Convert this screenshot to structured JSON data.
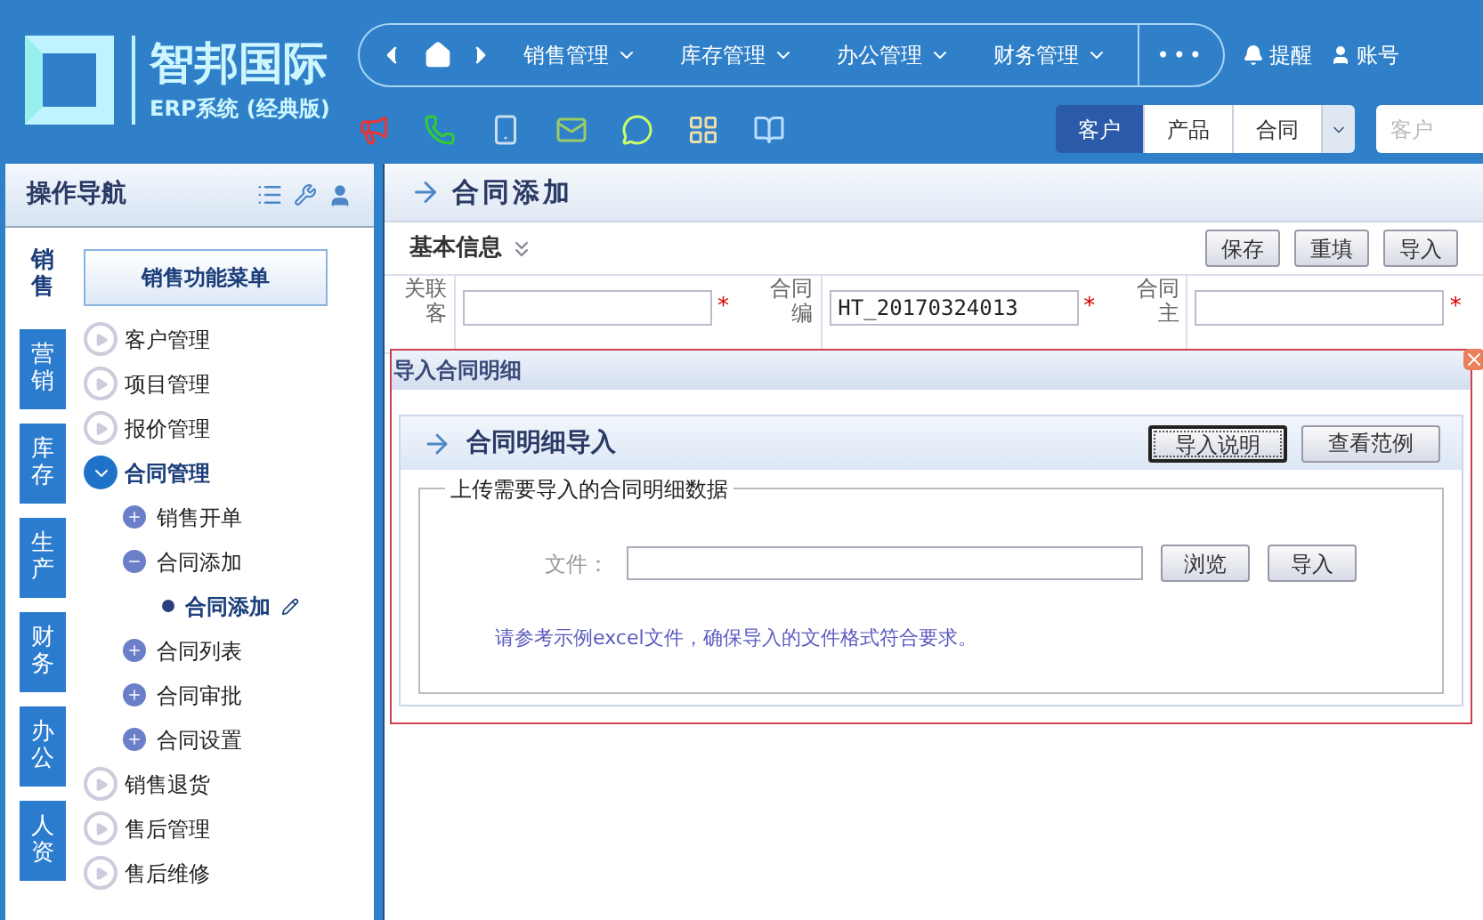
{
  "logo": {
    "title": "智邦国际",
    "subtitle": "ERP系统 (经典版)"
  },
  "nav": {
    "menus": [
      "销售管理",
      "库存管理",
      "办公管理",
      "财务管理"
    ],
    "more": "•••"
  },
  "user_links": [
    {
      "kind": "bell",
      "label": "提醒"
    },
    {
      "kind": "user",
      "label": "账号"
    }
  ],
  "toolbar_icons": [
    {
      "kind": "megaphone"
    },
    {
      "kind": "phone"
    },
    {
      "kind": "mobile"
    },
    {
      "kind": "mail"
    },
    {
      "kind": "chat"
    },
    {
      "kind": "grid"
    },
    {
      "kind": "book"
    }
  ],
  "search_tabs": [
    {
      "label": "客户",
      "selected": true
    },
    {
      "label": "产品",
      "selected": false
    },
    {
      "label": "合同",
      "selected": false
    }
  ],
  "search": {
    "placeholder": "客户"
  },
  "sidebar": {
    "title": "操作导航",
    "tabs": [
      {
        "label": "销售",
        "selected": true
      },
      {
        "label": "营销",
        "selected": false
      },
      {
        "label": "库存",
        "selected": false
      },
      {
        "label": "生产",
        "selected": false
      },
      {
        "label": "财务",
        "selected": false
      },
      {
        "label": "办公",
        "selected": false
      },
      {
        "label": "人资",
        "selected": false
      }
    ],
    "menu_title": "销售功能菜单",
    "tree": [
      {
        "label": "客户管理",
        "expanded": false
      },
      {
        "label": "项目管理",
        "expanded": false
      },
      {
        "label": "报价管理",
        "expanded": false
      },
      {
        "label": "合同管理",
        "expanded": true,
        "children": [
          {
            "label": "销售开单",
            "expanded": false
          },
          {
            "label": "合同添加",
            "expanded": true,
            "children": [
              {
                "label": "合同添加",
                "selected": true
              }
            ]
          },
          {
            "label": "合同列表",
            "expanded": false
          },
          {
            "label": "合同审批",
            "expanded": false
          },
          {
            "label": "合同设置",
            "expanded": false
          }
        ]
      },
      {
        "label": "销售退货",
        "expanded": false
      },
      {
        "label": "售后管理",
        "expanded": false
      },
      {
        "label": "售后维修",
        "expanded": false
      }
    ]
  },
  "page": {
    "title": "合同添加",
    "section": "基本信息",
    "buttons": [
      "保存",
      "重填",
      "导入"
    ],
    "fields": [
      {
        "label": "关联客",
        "mark": "*"
      },
      {
        "label": "合同编",
        "value": "HT_20170324013",
        "mark": "*"
      },
      {
        "label": "合同主",
        "mark": "*"
      }
    ]
  },
  "dialog": {
    "title": "导入合同明细",
    "panel_title": "合同明细导入",
    "buttons": [
      {
        "label": "导入说明",
        "focused": true
      },
      {
        "label": "查看范例",
        "focused": false
      }
    ],
    "group_title": "上传需要导入的合同明细数据",
    "file_label": "文件：",
    "browse": "浏览",
    "import": "导入",
    "note": "请参考示例excel文件，确保导入的文件格式符合要求。"
  }
}
